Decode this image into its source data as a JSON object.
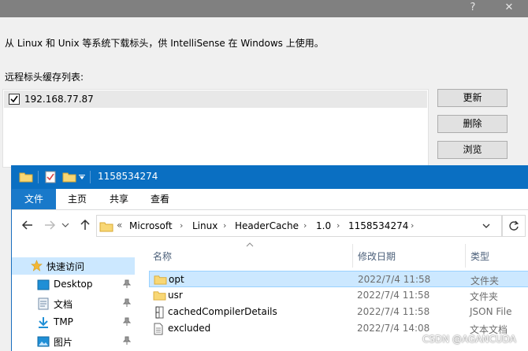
{
  "dialog": {
    "title_buttons": {
      "help": "?",
      "close": "✕"
    },
    "description": "从 Linux 和 Unix 等系统下载标头，供 IntelliSense 在 Windows 上使用。",
    "list_label": "远程标头缓存列表:",
    "hosts": [
      {
        "label": "192.168.77.87",
        "checked": true
      }
    ],
    "buttons": {
      "update": "更新",
      "delete": "删除",
      "browse": "浏览"
    }
  },
  "explorer": {
    "title": "1158534274",
    "ribbon_tabs": {
      "file": "文件",
      "home": "主页",
      "share": "共享",
      "view": "查看"
    },
    "address": {
      "overflow": "«",
      "segments": [
        "Microsoft",
        "Linux",
        "HeaderCache",
        "1.0",
        "1158534274"
      ]
    },
    "nav_pane": {
      "quick_access": "快速访问",
      "items": [
        {
          "label": "Desktop"
        },
        {
          "label": "文档"
        },
        {
          "label": "TMP"
        },
        {
          "label": "图片"
        }
      ]
    },
    "columns": {
      "name": "名称",
      "modified": "修改日期",
      "type": "类型"
    },
    "files": [
      {
        "name": "opt",
        "modified": "2022/7/4 11:58",
        "type": "文件夹",
        "kind": "folder",
        "selected": true
      },
      {
        "name": "usr",
        "modified": "2022/7/4 11:58",
        "type": "文件夹",
        "kind": "folder",
        "selected": false
      },
      {
        "name": "cachedCompilerDetails",
        "modified": "2022/7/4 11:58",
        "type": "JSON File",
        "kind": "json",
        "selected": false
      },
      {
        "name": "excluded",
        "modified": "2022/7/4 14:08",
        "type": "文本文档",
        "kind": "text",
        "selected": false
      }
    ]
  },
  "watermark": "CSDN @AGANCUDA",
  "colors": {
    "accent": "#0a6fc2",
    "selection": "#cce8ff",
    "folder": "#f8d775"
  }
}
